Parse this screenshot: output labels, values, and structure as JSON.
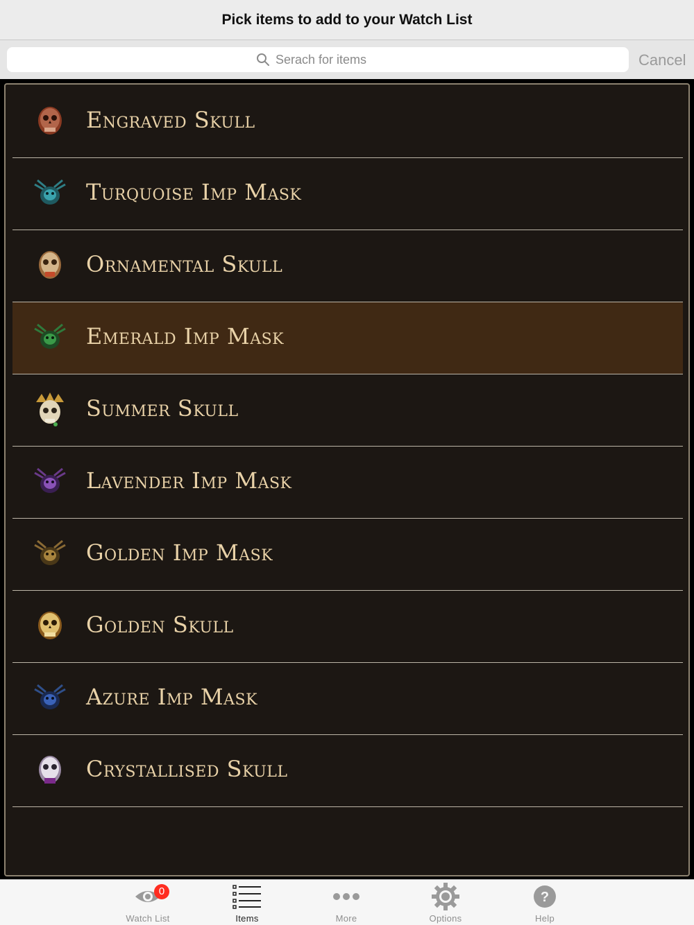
{
  "navbar": {
    "title": "Pick items to add to your Watch List"
  },
  "search": {
    "placeholder": "Serach for items",
    "cancel_label": "Cancel"
  },
  "items": [
    {
      "label": "Engraved Skull",
      "icon": "engraved-skull-icon",
      "selected": false
    },
    {
      "label": "Turquoise Imp Mask",
      "icon": "turquoise-imp-mask-icon",
      "selected": false
    },
    {
      "label": "Ornamental Skull",
      "icon": "ornamental-skull-icon",
      "selected": false
    },
    {
      "label": "Emerald Imp Mask",
      "icon": "emerald-imp-mask-icon",
      "selected": true
    },
    {
      "label": "Summer Skull",
      "icon": "summer-skull-icon",
      "selected": false
    },
    {
      "label": "Lavender Imp Mask",
      "icon": "lavender-imp-mask-icon",
      "selected": false
    },
    {
      "label": "Golden Imp Mask",
      "icon": "golden-imp-mask-icon",
      "selected": false
    },
    {
      "label": "Golden Skull",
      "icon": "golden-skull-icon",
      "selected": false
    },
    {
      "label": "Azure Imp Mask",
      "icon": "azure-imp-mask-icon",
      "selected": false
    },
    {
      "label": "Crystallised Skull",
      "icon": "crystallised-skull-icon",
      "selected": false
    }
  ],
  "tabbar": {
    "tabs": [
      {
        "label": "Watch List",
        "icon": "eye-icon",
        "active": false,
        "badge": "0"
      },
      {
        "label": "Items",
        "icon": "list-icon",
        "active": true
      },
      {
        "label": "More",
        "icon": "more-dots-icon",
        "active": false
      },
      {
        "label": "Options",
        "icon": "gear-icon",
        "active": false
      },
      {
        "label": "Help",
        "icon": "help-icon",
        "active": false
      }
    ]
  },
  "colors": {
    "list_background": "#1c1713",
    "selected_row": "#402914",
    "item_text": "#e9d2a8",
    "badge": "#ff2d21"
  }
}
